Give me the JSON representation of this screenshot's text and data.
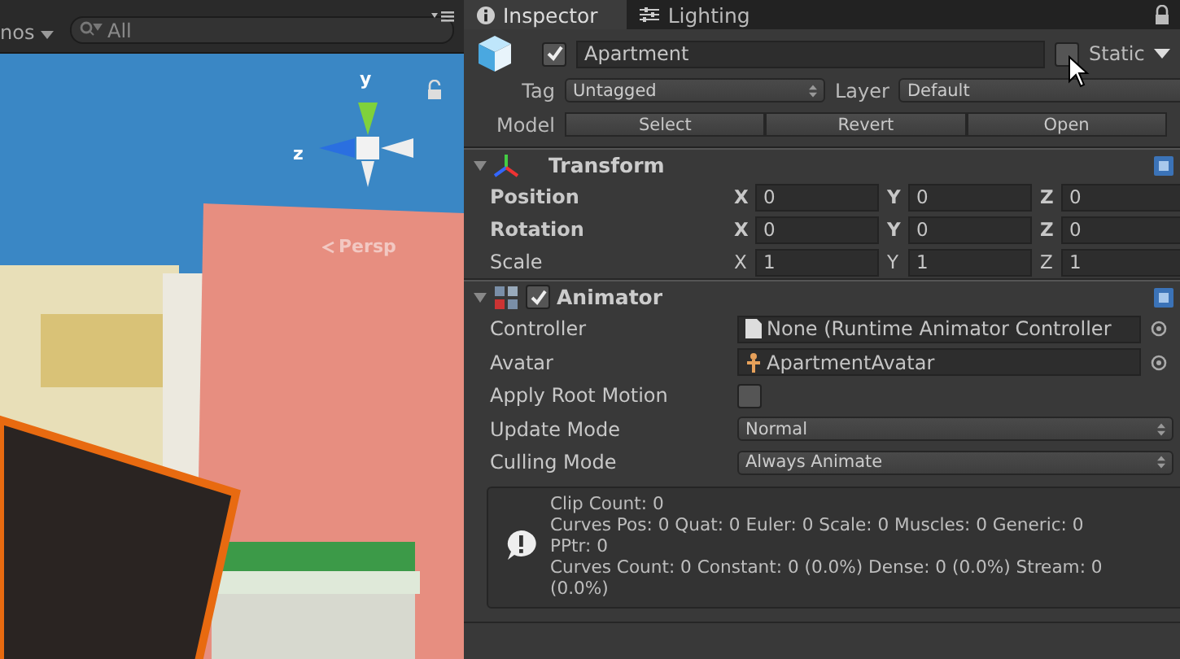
{
  "scene": {
    "gizmos_menu": "nos",
    "search": {
      "placeholder": "All"
    },
    "gizmo_labels": [
      "y",
      "z"
    ],
    "projection": "Persp"
  },
  "inspector": {
    "tabs": [
      {
        "label": "Inspector",
        "selected": true
      },
      {
        "label": "Lighting",
        "selected": false
      }
    ],
    "object": {
      "active": true,
      "name": "Apartment",
      "static": false,
      "static_label": "Static"
    },
    "tag": {
      "label": "Tag",
      "value": "Untagged"
    },
    "layer": {
      "label": "Layer",
      "value": "Default"
    },
    "model": {
      "label": "Model",
      "buttons": [
        "Select",
        "Revert",
        "Open"
      ]
    },
    "components": [
      {
        "kind": "transform",
        "title": "Transform",
        "expanded": true,
        "rows": [
          {
            "label": "Position",
            "overridden": true,
            "values": [
              {
                "axis": "X",
                "value": "0"
              },
              {
                "axis": "Y",
                "value": "0"
              },
              {
                "axis": "Z",
                "value": "0"
              }
            ]
          },
          {
            "label": "Rotation",
            "overridden": true,
            "values": [
              {
                "axis": "X",
                "value": "0"
              },
              {
                "axis": "Y",
                "value": "0"
              },
              {
                "axis": "Z",
                "value": "0"
              }
            ]
          },
          {
            "label": "Scale",
            "overridden": false,
            "values": [
              {
                "axis": "X",
                "value": "1"
              },
              {
                "axis": "Y",
                "value": "1"
              },
              {
                "axis": "Z",
                "value": "1"
              }
            ]
          }
        ]
      },
      {
        "kind": "animator",
        "title": "Animator",
        "enabled": true,
        "expanded": true,
        "rows": [
          {
            "kind": "object",
            "label": "Controller",
            "value": "None (Runtime Animator Controller"
          },
          {
            "kind": "object",
            "label": "Avatar",
            "value": "ApartmentAvatar"
          },
          {
            "kind": "toggle",
            "label": "Apply Root Motion",
            "checked": false
          },
          {
            "kind": "dropdown",
            "label": "Update Mode",
            "value": "Normal"
          },
          {
            "kind": "dropdown",
            "label": "Culling Mode",
            "value": "Always Animate"
          }
        ],
        "info": [
          "Clip Count: 0",
          "Curves Pos: 0 Quat: 0 Euler: 0 Scale: 0 Muscles: 0 Generic: 0",
          "PPtr: 0",
          "Curves Count: 0 Constant: 0 (0.0%) Dense: 0 (0.0%) Stream: 0",
          "(0.0%)"
        ]
      }
    ]
  }
}
